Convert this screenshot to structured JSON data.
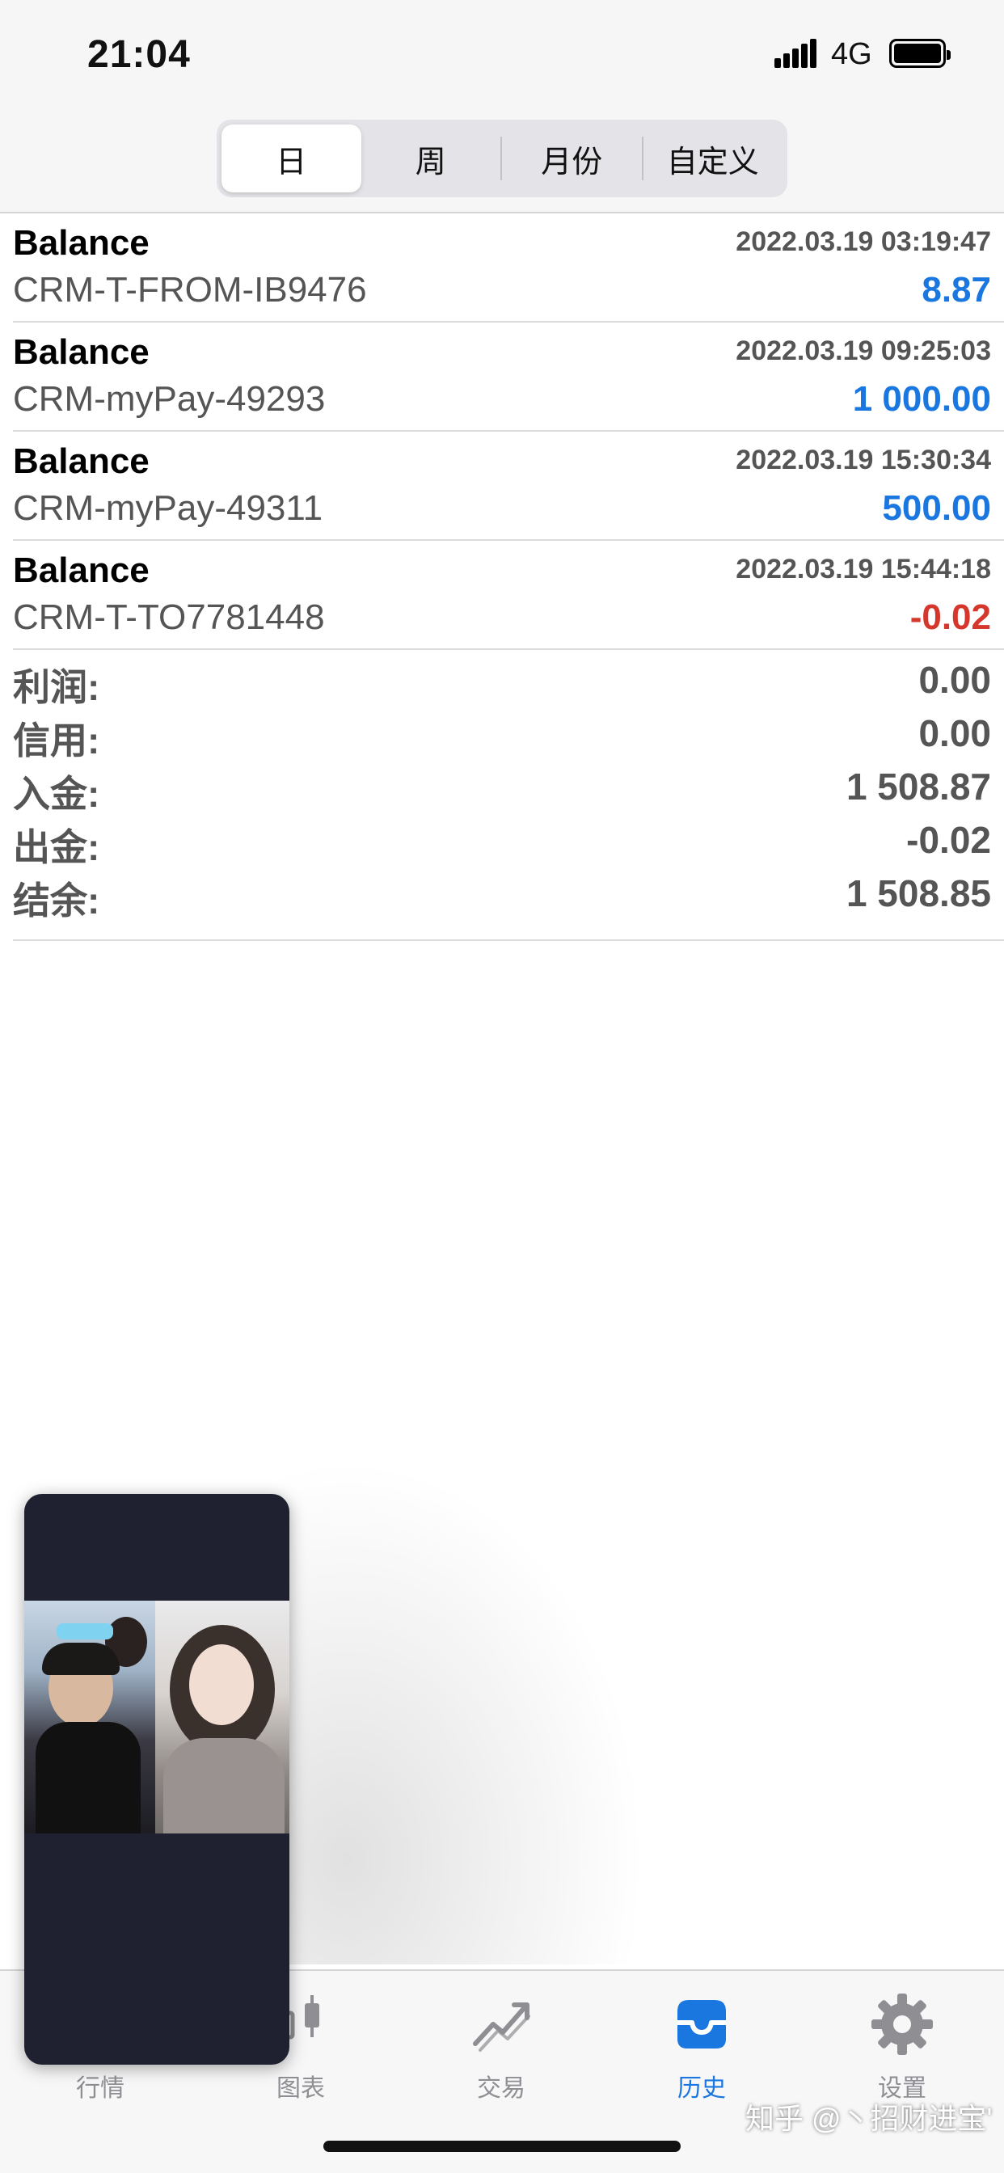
{
  "status_bar": {
    "time": "21:04",
    "network": "4G"
  },
  "segmented": {
    "tabs": [
      "日",
      "周",
      "月份",
      "自定义"
    ],
    "active_index": 0
  },
  "deals": [
    {
      "type": "Balance",
      "datetime": "2022.03.19 03:19:47",
      "comment": "CRM-T-FROM-IB9476",
      "amount": "8.87",
      "sign": "positive"
    },
    {
      "type": "Balance",
      "datetime": "2022.03.19 09:25:03",
      "comment": "CRM-myPay-49293",
      "amount": "1 000.00",
      "sign": "positive"
    },
    {
      "type": "Balance",
      "datetime": "2022.03.19 15:30:34",
      "comment": "CRM-myPay-49311",
      "amount": "500.00",
      "sign": "positive"
    },
    {
      "type": "Balance",
      "datetime": "2022.03.19 15:44:18",
      "comment": "CRM-T-TO7781448",
      "amount": "-0.02",
      "sign": "negative"
    }
  ],
  "summary": [
    {
      "label": "利润:",
      "value": "0.00"
    },
    {
      "label": "信用:",
      "value": "0.00"
    },
    {
      "label": "入金:",
      "value": "1 508.87"
    },
    {
      "label": "出金:",
      "value": "-0.02"
    },
    {
      "label": "结余:",
      "value": "1 508.85"
    }
  ],
  "tabbar": {
    "items": [
      {
        "label": "行情",
        "icon": "quotes-icon"
      },
      {
        "label": "图表",
        "icon": "candlestick-chart-icon"
      },
      {
        "label": "交易",
        "icon": "trade-trend-icon"
      },
      {
        "label": "历史",
        "icon": "history-inbox-icon"
      },
      {
        "label": "设置",
        "icon": "gear-icon"
      }
    ],
    "active_index": 3
  },
  "watermark": "知乎 @丶招财进宝'",
  "colors": {
    "positive": "#1a77e0",
    "negative": "#d6372c",
    "active_tab": "#1a77e0",
    "inactive_tab": "#8e8e93"
  }
}
